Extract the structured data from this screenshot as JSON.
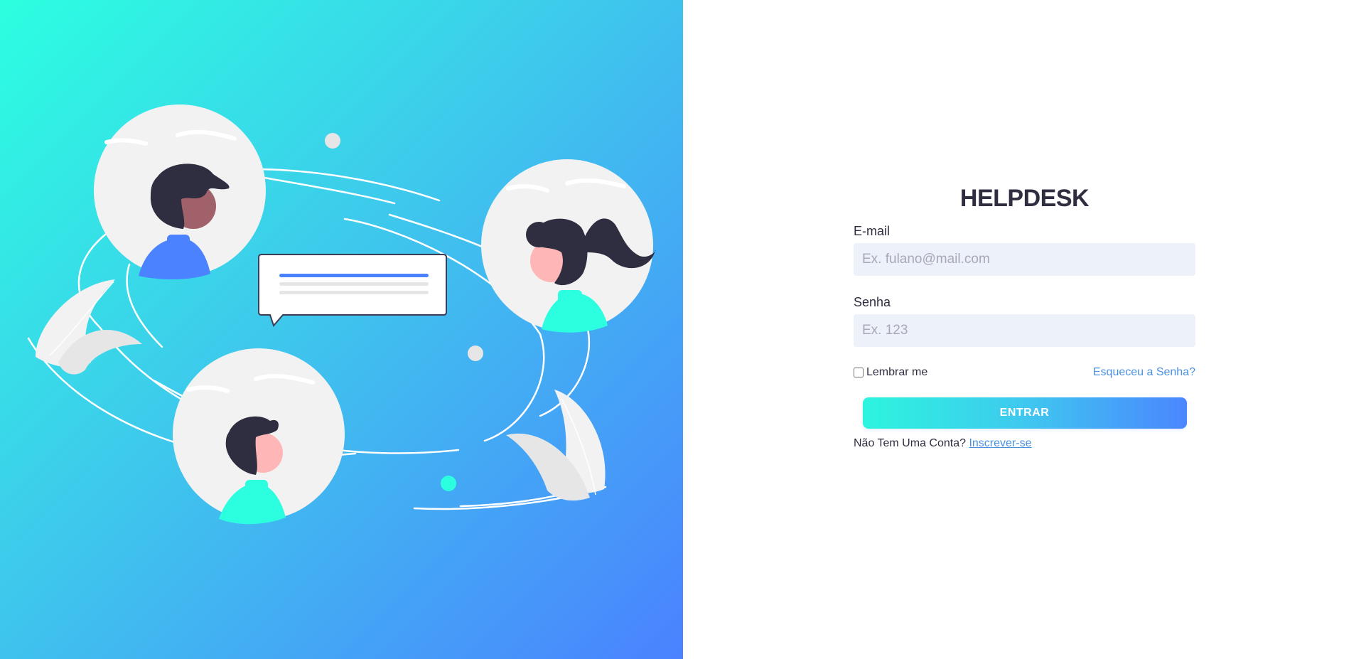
{
  "illustration": {
    "name": "people-chatting-illustration",
    "colors": {
      "gradient_start": "#2cffe0",
      "gradient_end": "#4a82ff",
      "dark": "#2f2e41",
      "circle": "#f2f2f2",
      "accent_blue": "#4a82ff",
      "accent_teal": "#2cffe0"
    }
  },
  "login": {
    "title": "HELPDESK",
    "email": {
      "label": "E-mail",
      "placeholder": "Ex. fulano@mail.com",
      "value": ""
    },
    "password": {
      "label": "Senha",
      "placeholder": "Ex. 123",
      "value": ""
    },
    "remember_label": "Lembrar me",
    "remember_checked": false,
    "forgot_label": "Esqueceu a Senha?",
    "submit_label": "ENTRAR",
    "signup_prompt": "Não Tem Uma Conta?",
    "signup_link": "Inscrever-se"
  }
}
